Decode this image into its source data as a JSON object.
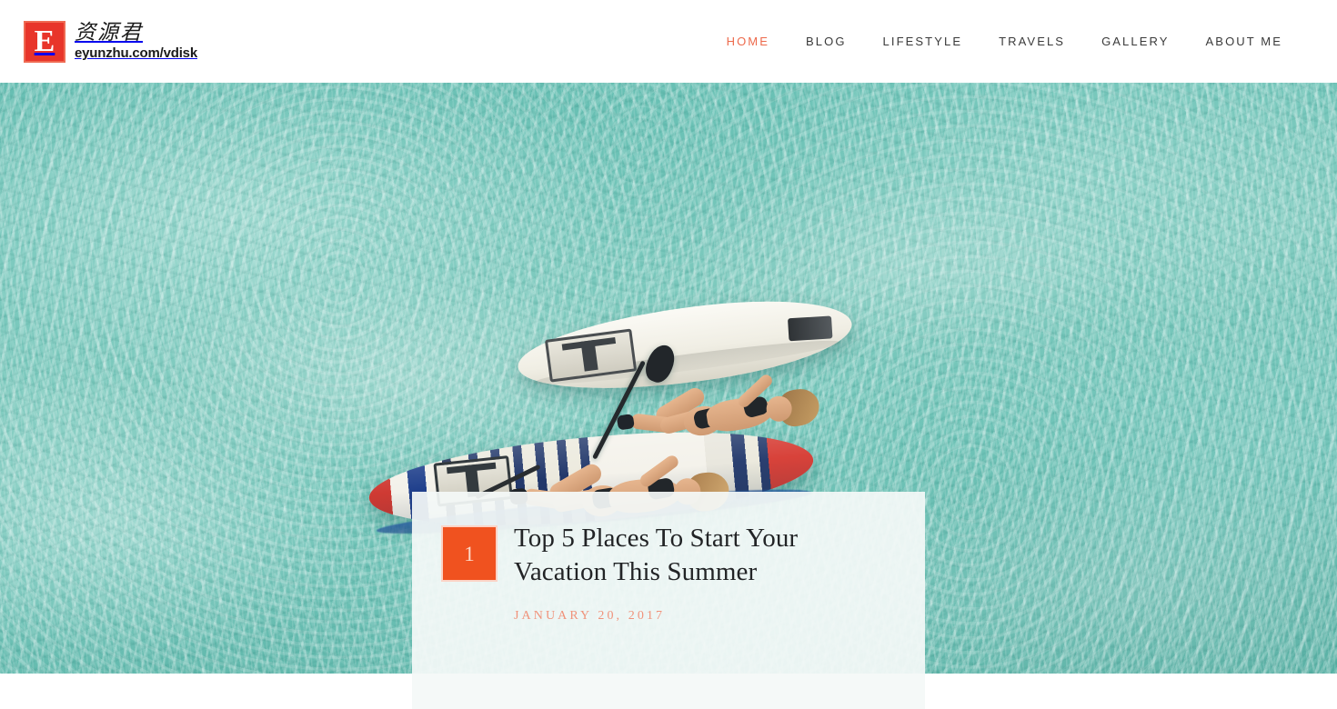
{
  "site": {
    "brand": {
      "logo_letter": "E",
      "name_cn": "资源君",
      "url": "eyunzhu.com/vdisk",
      "logo_color": "#e8352a"
    },
    "nav": {
      "items": [
        {
          "label": "HOME",
          "active": true
        },
        {
          "label": "BLOG",
          "active": false
        },
        {
          "label": "LIFESTYLE",
          "active": false
        },
        {
          "label": "TRAVELS",
          "active": false
        },
        {
          "label": "GALLERY",
          "active": false
        },
        {
          "label": "ABOUT ME",
          "active": false
        }
      ],
      "active_color": "#ed6a4c",
      "inactive_color": "#3a3a3a"
    }
  },
  "hero": {
    "image_alt": "Two women sunbathing on stand-up paddleboards in clear turquoise shallow water",
    "water_color": "#6cc2b6"
  },
  "featured_post": {
    "rank": "1",
    "rank_badge_color": "#f0521f",
    "title": "Top 5 Places To Start Your Vacation This Summer",
    "date": "JANUARY 20, 2017",
    "date_color": "#f0927a",
    "card_background": "#f4f9f7"
  }
}
